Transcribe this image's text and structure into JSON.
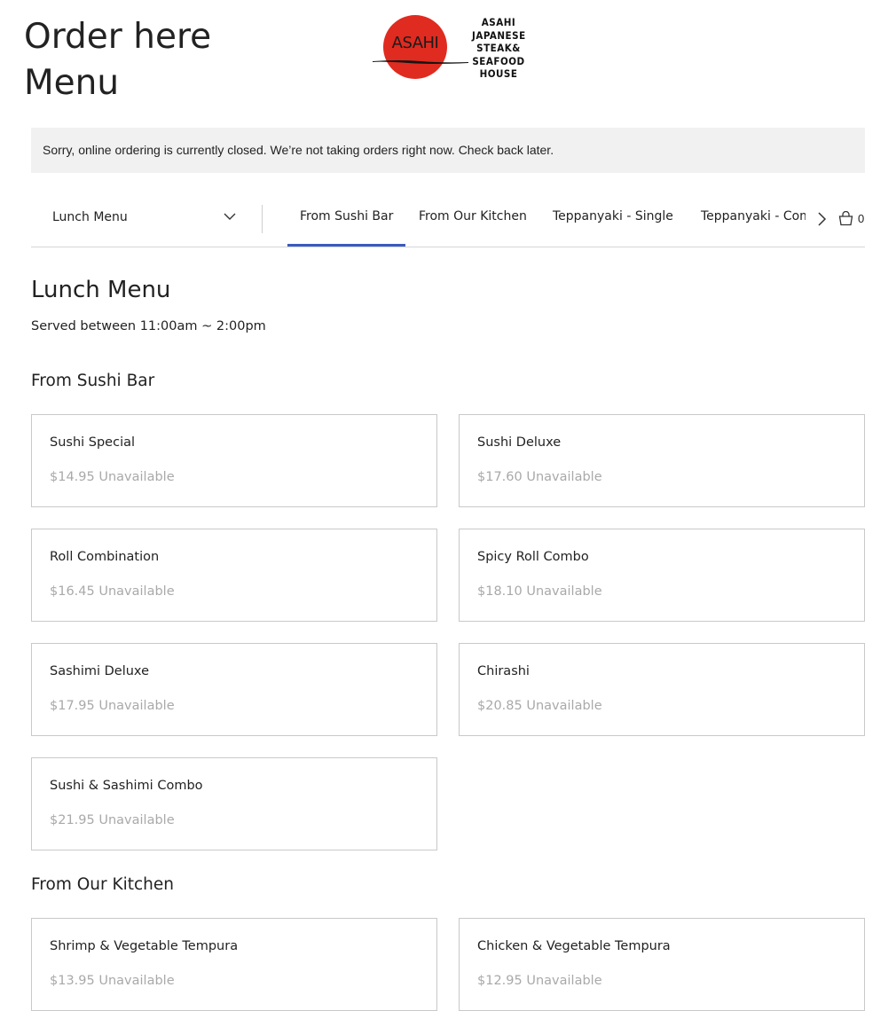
{
  "header": {
    "title_line1": "Order here",
    "title_line2": "Menu"
  },
  "logo": {
    "mark": "ASAHI",
    "lines": [
      "ASAHI",
      "JAPANESE",
      "STEAK&",
      "SEAFOOD",
      "HOUSE"
    ],
    "brand_color": "#e02b20"
  },
  "notice": {
    "text": "Sorry, online ordering is currently closed. We’re not taking orders right now. Check back later."
  },
  "menu_selector": {
    "selected": "Lunch Menu"
  },
  "tabs": [
    {
      "label": "From Sushi Bar",
      "active": true
    },
    {
      "label": "From Our Kitchen",
      "active": false
    },
    {
      "label": "Teppanyaki - Single",
      "active": false
    },
    {
      "label": "Teppanyaki - Combo",
      "active": false
    }
  ],
  "cart": {
    "count": "0"
  },
  "menu": {
    "title": "Lunch Menu",
    "description": "Served between 11:00am ~ 2:00pm"
  },
  "sections": [
    {
      "title": "From Sushi Bar",
      "items": [
        {
          "name": "Sushi Special",
          "price": "$14.95",
          "status": "Unavailable"
        },
        {
          "name": "Sushi Deluxe",
          "price": "$17.60",
          "status": "Unavailable"
        },
        {
          "name": "Roll Combination",
          "price": "$16.45",
          "status": "Unavailable"
        },
        {
          "name": "Spicy Roll Combo",
          "price": "$18.10",
          "status": "Unavailable"
        },
        {
          "name": "Sashimi Deluxe",
          "price": "$17.95",
          "status": "Unavailable"
        },
        {
          "name": "Chirashi",
          "price": "$20.85",
          "status": "Unavailable"
        },
        {
          "name": "Sushi & Sashimi Combo",
          "price": "$21.95",
          "status": "Unavailable"
        }
      ]
    },
    {
      "title": "From Our Kitchen",
      "items": [
        {
          "name": "Shrimp & Vegetable Tempura",
          "price": "$13.95",
          "status": "Unavailable"
        },
        {
          "name": "Chicken & Vegetable Tempura",
          "price": "$12.95",
          "status": "Unavailable"
        }
      ]
    }
  ],
  "colors": {
    "accent": "#3b5bbf",
    "unavailable_text": "#a9a9a9",
    "notice_bg": "#f1f1f1"
  }
}
